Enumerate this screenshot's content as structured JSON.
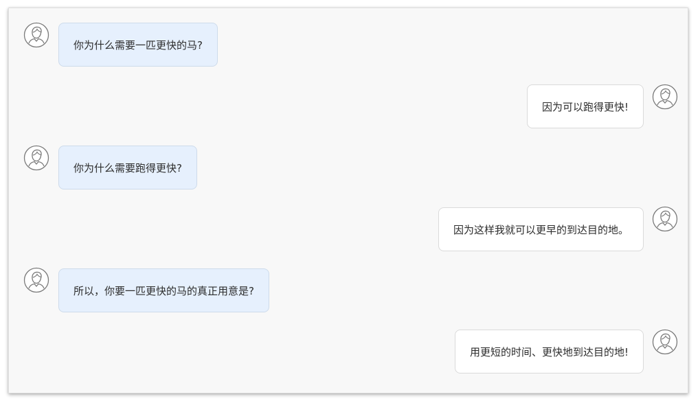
{
  "chat": {
    "messages": [
      {
        "side": "left",
        "text": "你为什么需要一匹更快的马?",
        "avatar_icon": "user-avatar-icon"
      },
      {
        "side": "right",
        "text": "因为可以跑得更快!",
        "avatar_icon": "user-avatar-icon"
      },
      {
        "side": "left",
        "text": "你为什么需要跑得更快?",
        "avatar_icon": "user-avatar-icon"
      },
      {
        "side": "right",
        "text": "因为这样我就可以更早的到达目的地。",
        "avatar_icon": "user-avatar-icon"
      },
      {
        "side": "left",
        "text": "所以，你要一匹更快的马的真正用意是?",
        "avatar_icon": "user-avatar-icon"
      },
      {
        "side": "right",
        "text": "用更短的时间、更快地到达目的地!",
        "avatar_icon": "user-avatar-icon"
      }
    ]
  },
  "colors": {
    "left_bubble_bg": "#e6f0fd",
    "right_bubble_bg": "#ffffff",
    "frame_bg": "#f8f8f8"
  }
}
